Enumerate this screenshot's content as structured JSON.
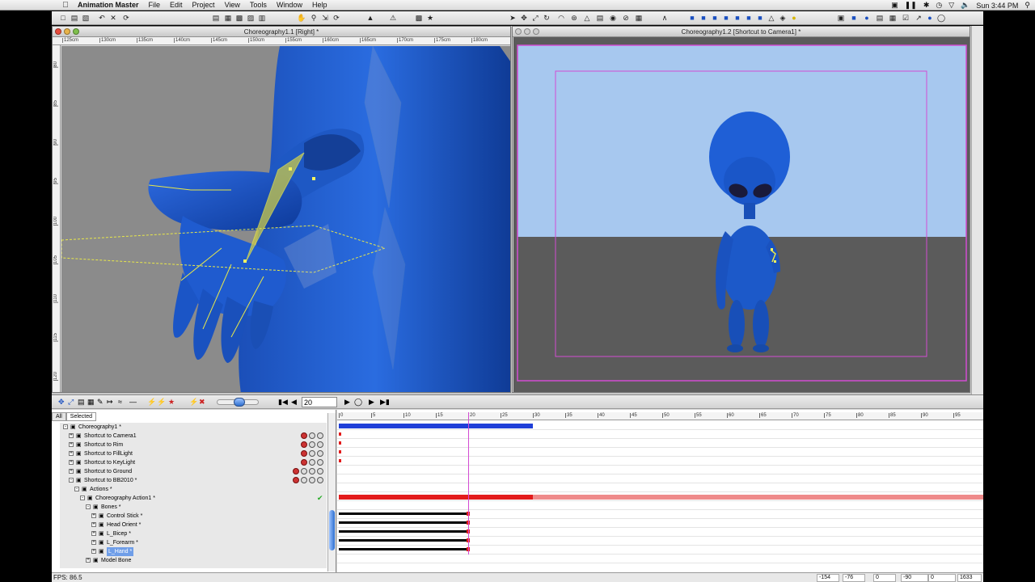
{
  "menubar": {
    "app_name": "Animation Master",
    "menus": [
      "File",
      "Edit",
      "Project",
      "View",
      "Tools",
      "Window",
      "Help"
    ],
    "clock": "Sun 3:44 PM"
  },
  "windows": {
    "right": {
      "title": "Choreography1.1 [Right] *",
      "ruler_top": [
        "125cm",
        "130cm",
        "135cm",
        "140cm",
        "145cm",
        "150cm",
        "155cm",
        "160cm",
        "165cm",
        "170cm",
        "175cm",
        "180cm"
      ],
      "ruler_left": [
        "80",
        "85",
        "90",
        "95",
        "100",
        "105",
        "110",
        "115",
        "120"
      ]
    },
    "camera": {
      "title": "Choreography1.2 [Shortcut to Camera1] *"
    }
  },
  "timeline": {
    "frame_value": "20",
    "ruler_ticks": [
      "0",
      "5",
      "10",
      "15",
      "20",
      "25",
      "30",
      "35",
      "40",
      "45",
      "50",
      "55",
      "60",
      "65",
      "70",
      "75",
      "80",
      "85",
      "90",
      "95"
    ],
    "tabs": [
      "All",
      "Selected"
    ],
    "tree": [
      {
        "label": "Choreography1 *",
        "indent": 0,
        "twisty": "-"
      },
      {
        "label": "Shortcut to Camera1",
        "indent": 1,
        "twisty": "+"
      },
      {
        "label": "Shortcut to Rim",
        "indent": 1,
        "twisty": "+"
      },
      {
        "label": "Shortcut to FillLight",
        "indent": 1,
        "twisty": "+"
      },
      {
        "label": "Shortcut to KeyLight",
        "indent": 1,
        "twisty": "+"
      },
      {
        "label": "Shortcut to Ground",
        "indent": 1,
        "twisty": "+"
      },
      {
        "label": "Shortcut to BB2010 *",
        "indent": 1,
        "twisty": "-"
      },
      {
        "label": "Actions *",
        "indent": 2,
        "twisty": "-"
      },
      {
        "label": "Choreography Action1 *",
        "indent": 3,
        "twisty": "-"
      },
      {
        "label": "Bones *",
        "indent": 4,
        "twisty": "-"
      },
      {
        "label": "Control Stick *",
        "indent": 5,
        "twisty": "+"
      },
      {
        "label": "Head Orient *",
        "indent": 5,
        "twisty": "+"
      },
      {
        "label": "L_Bicep *",
        "indent": 5,
        "twisty": "+"
      },
      {
        "label": "L_Forearm *",
        "indent": 5,
        "twisty": "+"
      },
      {
        "label": "L_Hand *",
        "indent": 5,
        "twisty": "+",
        "selected": true
      },
      {
        "label": "Model Bone",
        "indent": 4,
        "twisty": "+"
      }
    ]
  },
  "status": {
    "fps": "FPS: 86.5",
    "coords": [
      "-154",
      "-76",
      "0",
      "-90",
      "0",
      "1633"
    ]
  },
  "colors": {
    "sky": "#a7c8ef",
    "ground": "#5b5b5b",
    "alien_blue": "#1b5fd1",
    "selection": "#d34cd3",
    "bone_yellow": "#e8e84a"
  }
}
